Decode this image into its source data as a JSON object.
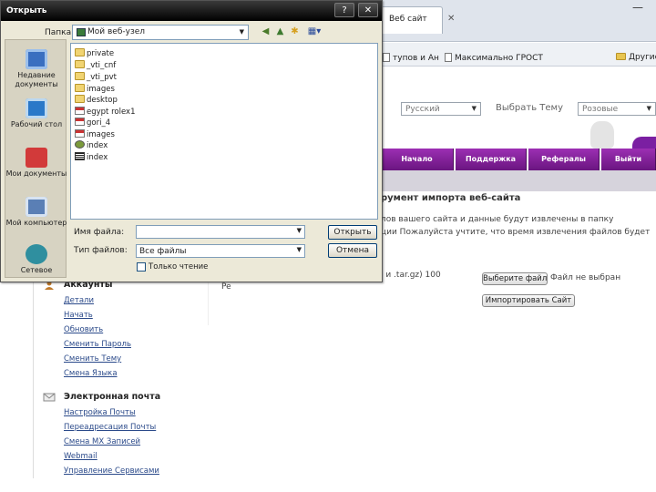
{
  "browser": {
    "tab_title": "Веб сайт",
    "tab_close": "✕",
    "minimize": "—",
    "bookmarks": [
      {
        "label": "тупов и Ан"
      },
      {
        "label": "Максимально ГРОСТ"
      },
      {
        "label": "Другие"
      }
    ],
    "language_select": "Русский",
    "theme_label": "Выбрать Тему",
    "theme_select": "Розовые",
    "nav": [
      "Начало",
      "Поддержка",
      "Рефералы",
      "Выйти"
    ],
    "content_title": "румент импорта веб-сайта",
    "content_lines": [
      "лов вашего сайта и данные будут извлечены в папку",
      "ции Пожалуйста учтите, что время извлечения файлов будет",
      "і и .tar.gz) 100"
    ],
    "choose_file_btn": "Выберите файл",
    "no_file_text": "Файл не выбран",
    "import_btn": "Импортировать Сайт",
    "pe_text": "Pe",
    "accounts_title": "Аккаунты",
    "account_links": [
      "Детали",
      "Начать",
      "Обновить",
      "Сменить Пароль",
      "Сменить Тему",
      "Смена Языка"
    ],
    "email_title": "Электронная почта",
    "email_links": [
      "Настройка Почты",
      "Переадресация Почты",
      "Смена MX Записей",
      "Webmail",
      "Управление Сервисами"
    ]
  },
  "dialog": {
    "title": "Открыть",
    "help_btn": "?",
    "close_btn": "✕",
    "lookin_label": "Папка:",
    "lookin_value": "Мой веб-узел",
    "places": [
      "Недавние документы",
      "Рабочий стол",
      "Мои документы",
      "Мой компьютер",
      "Сетевое"
    ],
    "files": [
      {
        "name": "private",
        "icon": "folder-icon"
      },
      {
        "name": "_vti_cnf",
        "icon": "folder-icon"
      },
      {
        "name": "_vti_pvt",
        "icon": "folder-icon"
      },
      {
        "name": "images",
        "icon": "folder-icon"
      },
      {
        "name": "desktop",
        "icon": "folder-icon"
      },
      {
        "name": "egypt rolex1",
        "icon": "html-icon"
      },
      {
        "name": "gori_4",
        "icon": "html-icon"
      },
      {
        "name": "images",
        "icon": "html-icon"
      },
      {
        "name": "index",
        "icon": "php-icon"
      },
      {
        "name": "index",
        "icon": "index-icon"
      }
    ],
    "filename_label": "Имя файла:",
    "filename_value": "",
    "filetype_label": "Тип файлов:",
    "filetype_value": "Все файлы",
    "open_btn": "Открыть",
    "cancel_btn": "Отмена",
    "readonly_label": "Только чтение"
  }
}
